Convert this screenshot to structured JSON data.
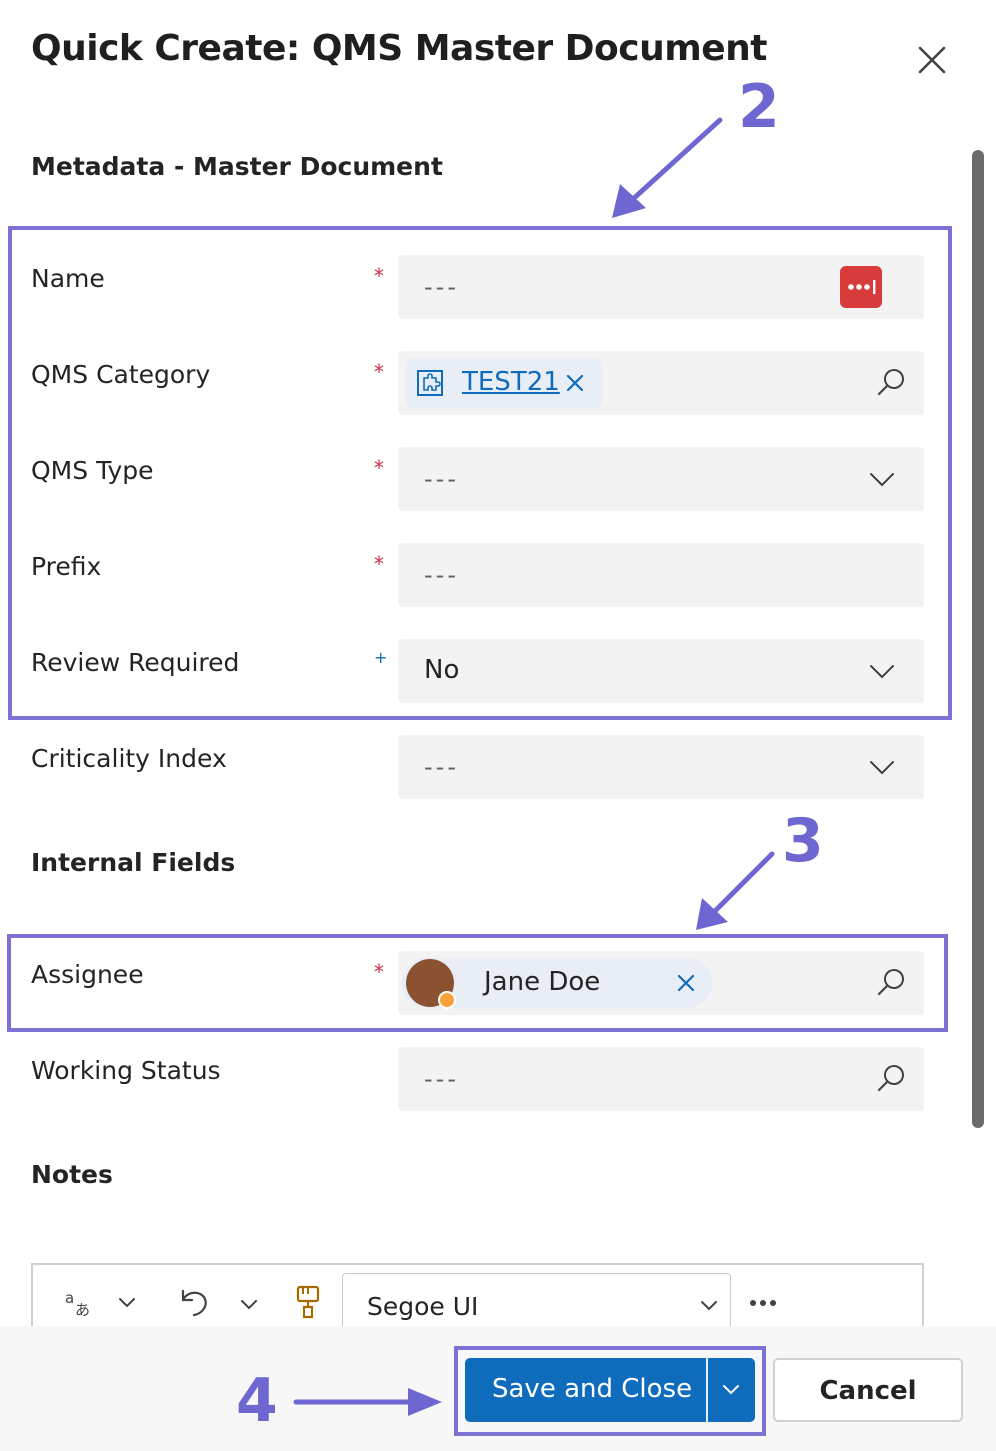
{
  "dialog": {
    "title": "Quick Create: QMS Master Document"
  },
  "sections": {
    "metadata": "Metadata - Master Document",
    "internal": "Internal Fields",
    "notes": "Notes"
  },
  "fields": {
    "name": {
      "label": "Name",
      "required_marker": "*",
      "value": "---"
    },
    "qms_category": {
      "label": "QMS Category",
      "required_marker": "*",
      "tag": "TEST21"
    },
    "qms_type": {
      "label": "QMS Type",
      "required_marker": "*",
      "value": "---"
    },
    "prefix": {
      "label": "Prefix",
      "required_marker": "*",
      "value": "---"
    },
    "review_required": {
      "label": "Review Required",
      "recommended_marker": "+",
      "value": "No"
    },
    "criticality_index": {
      "label": "Criticality Index",
      "value": "---"
    },
    "assignee": {
      "label": "Assignee",
      "required_marker": "*",
      "person": "Jane Doe"
    },
    "working_status": {
      "label": "Working Status",
      "value": "---"
    }
  },
  "editor_toolbar": {
    "font": "Segoe UI"
  },
  "footer": {
    "save_label": "Save and Close",
    "cancel_label": "Cancel"
  },
  "annotations": {
    "callout_2": "2",
    "callout_3": "3",
    "callout_4": "4"
  },
  "colors": {
    "accent": "#0f6cbd",
    "annotation": "#7b72d4",
    "required": "#c4314b",
    "field_bg": "#f3f3f3"
  },
  "icons": [
    "close-icon",
    "password-manager-icon",
    "entity-icon",
    "remove-icon",
    "search-icon",
    "chevron-down-icon",
    "translate-icon",
    "undo-icon",
    "format-painter-icon",
    "more-icon"
  ]
}
